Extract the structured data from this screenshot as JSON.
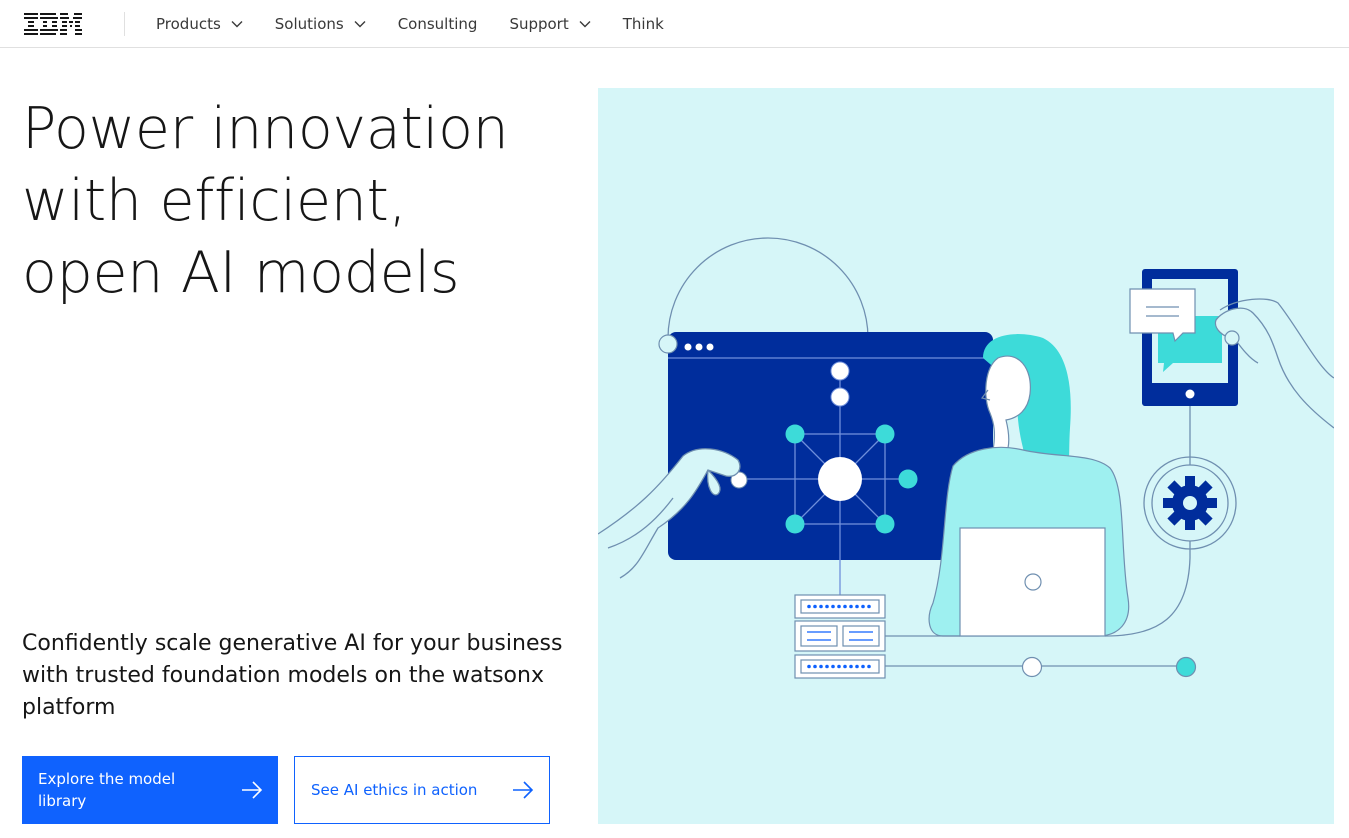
{
  "header": {
    "logo_text": "IBM",
    "nav": [
      {
        "label": "Products",
        "has_dropdown": true
      },
      {
        "label": "Solutions",
        "has_dropdown": true
      },
      {
        "label": "Consulting",
        "has_dropdown": false
      },
      {
        "label": "Support",
        "has_dropdown": true
      },
      {
        "label": "Think",
        "has_dropdown": false
      }
    ]
  },
  "hero": {
    "title_lines": [
      "Power innovation",
      "with efficient,",
      "open AI models"
    ],
    "subtitle": "Confidently scale generative AI for your business with trusted foundation models on the watsonx platform",
    "primary_cta": "Explore the model library",
    "secondary_cta": "See AI ethics in action"
  },
  "icons": {
    "nav_dropdown": "chevron-down-icon",
    "cta": "arrow-right-icon"
  },
  "colors": {
    "brand_blue": "#0f62fe",
    "illustration_bg": "#d6f6f8",
    "dark_navy": "#002d9c",
    "teal": "#3ddbd9",
    "text": "#161616"
  }
}
